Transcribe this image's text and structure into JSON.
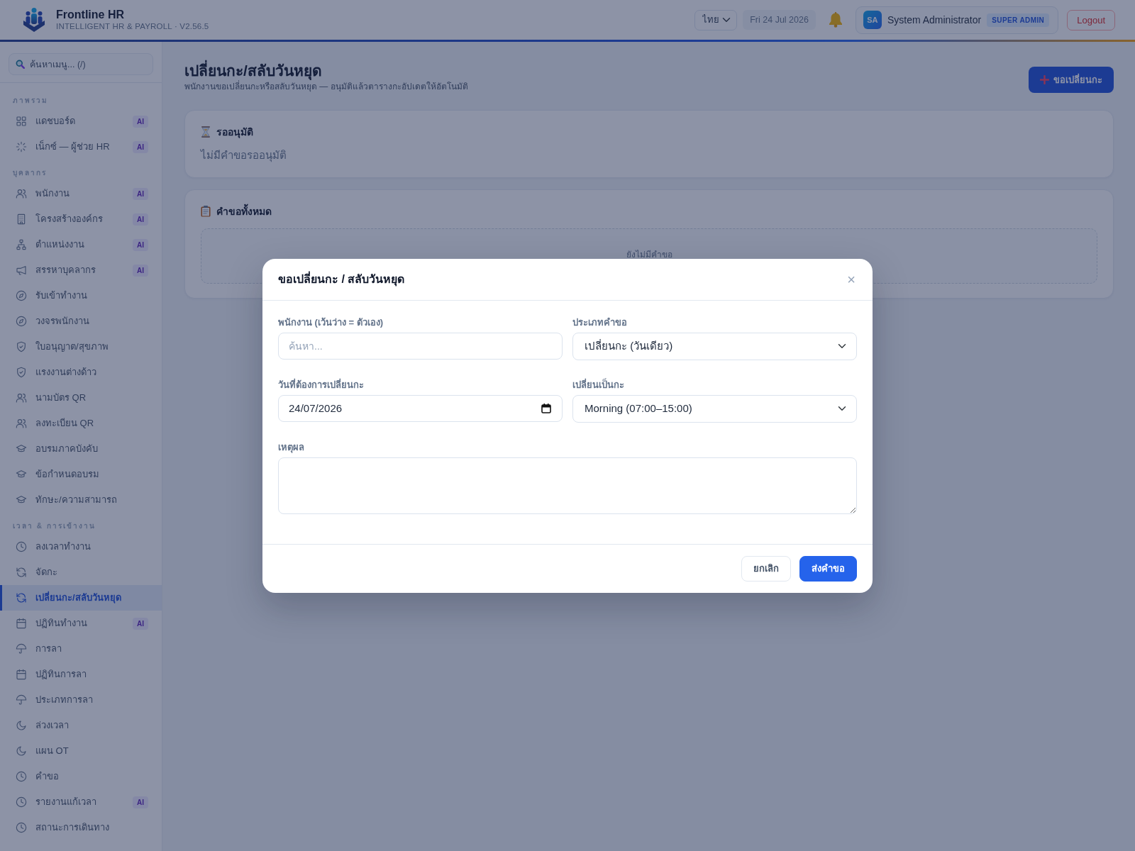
{
  "header": {
    "app_name": "Frontline HR",
    "subtitle": "INTELLIGENT HR & PAYROLL · V2.56.5",
    "language": "ไทย",
    "date": "Fri 24 Jul 2026",
    "user": {
      "initials": "SA",
      "name": "System Administrator",
      "role": "SUPER ADMIN"
    },
    "logout": "Logout"
  },
  "sidebar": {
    "search_placeholder": "ค้นหาเมนู... (/)",
    "sections": [
      {
        "title": "ภาพรวม",
        "items": [
          {
            "label": "แดชบอร์ด",
            "kind": "grid",
            "badge": "AI",
            "selected": false
          },
          {
            "label": "เน็กซ์ — ผู้ช่วย HR",
            "kind": "sparkle",
            "badge": "AI",
            "selected": false
          }
        ]
      },
      {
        "title": "บุคลากร",
        "items": [
          {
            "label": "พนักงาน",
            "kind": "users",
            "badge": "AI",
            "selected": false
          },
          {
            "label": "โครงสร้างองค์กร",
            "kind": "building",
            "badge": "AI",
            "selected": false
          },
          {
            "label": "ตำแหน่งงาน",
            "kind": "sitemap",
            "badge": "AI",
            "selected": false
          },
          {
            "label": "สรรหาบุคลากร",
            "kind": "megaphone",
            "badge": "AI",
            "selected": false
          },
          {
            "label": "รับเข้าทำงาน",
            "kind": "compass",
            "selected": false
          },
          {
            "label": "วงจรพนักงาน",
            "kind": "compass",
            "selected": false
          },
          {
            "label": "ใบอนุญาต/สุขภาพ",
            "kind": "shield",
            "selected": false
          },
          {
            "label": "แรงงานต่างด้าว",
            "kind": "shield",
            "selected": false
          },
          {
            "label": "นามบัตร QR",
            "kind": "users",
            "selected": false
          },
          {
            "label": "ลงทะเบียน QR",
            "kind": "users",
            "selected": false
          },
          {
            "label": "อบรมภาคบังคับ",
            "kind": "cap",
            "selected": false
          },
          {
            "label": "ข้อกำหนดอบรม",
            "kind": "cap",
            "selected": false
          },
          {
            "label": "ทักษะ/ความสามารถ",
            "kind": "cap",
            "selected": false
          }
        ]
      },
      {
        "title": "เวลา & การเข้างาน",
        "items": [
          {
            "label": "ลงเวลาทำงาน",
            "kind": "clock",
            "selected": false
          },
          {
            "label": "จัดกะ",
            "kind": "refresh",
            "selected": false
          },
          {
            "label": "เปลี่ยนกะ/สลับวันหยุด",
            "kind": "refresh",
            "selected": true
          },
          {
            "label": "ปฏิทินทำงาน",
            "kind": "calendar",
            "badge": "AI",
            "selected": false
          },
          {
            "label": "การลา",
            "kind": "umbrella",
            "selected": false
          },
          {
            "label": "ปฏิทินการลา",
            "kind": "calendar",
            "selected": false
          },
          {
            "label": "ประเภทการลา",
            "kind": "umbrella",
            "selected": false
          },
          {
            "label": "ล่วงเวลา",
            "kind": "moon",
            "selected": false
          },
          {
            "label": "แผน OT",
            "kind": "moon",
            "selected": false
          },
          {
            "label": "คำขอ",
            "kind": "clock",
            "selected": false
          },
          {
            "label": "รายงานแก้เวลา",
            "kind": "clock",
            "badge": "AI",
            "selected": false
          },
          {
            "label": "สถานะการเดินทาง",
            "kind": "clock",
            "selected": false
          }
        ]
      }
    ]
  },
  "page": {
    "title": "เปลี่ยนกะ/สลับวันหยุด",
    "subtitle": "พนักงานขอเปลี่ยนกะหรือสลับวันหยุด — อนุมัติแล้วตารางกะอัปเดตให้อัตโนมัติ",
    "new_request_button": "ขอเปลี่ยนกะ",
    "cards": [
      {
        "kind": "pending",
        "title": "รออนุมัติ",
        "empty_text": "ไม่มีคำขอรออนุมัติ"
      },
      {
        "kind": "list",
        "title": "คำขอทั้งหมด",
        "empty_text": "ยังไม่มีคำขอ"
      }
    ]
  },
  "modal": {
    "title": "ขอเปลี่ยนกะ / สลับวันหยุด",
    "close": "×",
    "fields": [
      {
        "kind": "text",
        "label": "พนักงาน (เว้นว่าง = ตัวเอง)",
        "placeholder": "ค้นหา..."
      },
      {
        "kind": "select",
        "label": "ประเภทคำขอ",
        "value": "เปลี่ยนกะ (วันเดียว)"
      },
      {
        "kind": "date",
        "label": "วันที่ต้องการเปลี่ยนกะ",
        "value": "24/07/2026"
      },
      {
        "kind": "select",
        "label": "เปลี่ยนเป็นกะ",
        "value": "Morning (07:00–15:00)"
      },
      {
        "kind": "textarea",
        "label": "เหตุผล"
      }
    ],
    "buttons": [
      {
        "kind": "secondary",
        "label": "ยกเลิก"
      },
      {
        "kind": "primary",
        "label": "ส่งคำขอ"
      }
    ]
  }
}
